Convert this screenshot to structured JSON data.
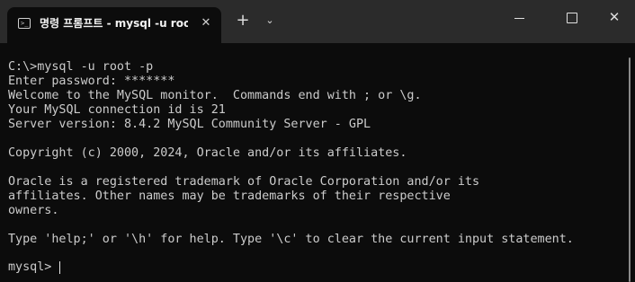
{
  "window": {
    "tab_title": "명령 프롬프트 - mysql  -u root",
    "tab_icon": "terminal-icon",
    "close_tab_symbol": "✕",
    "new_tab_symbol": "+",
    "dropdown_symbol": "⌄",
    "minimize_icon": "minimize-icon",
    "maximize_icon": "maximize-icon",
    "close_window_symbol": "✕"
  },
  "terminal": {
    "lines": [
      "C:\\>mysql -u root -p",
      "Enter password: *******",
      "Welcome to the MySQL monitor.  Commands end with ; or \\g.",
      "Your MySQL connection id is 21",
      "Server version: 8.4.2 MySQL Community Server - GPL",
      "",
      "Copyright (c) 2000, 2024, Oracle and/or its affiliates.",
      "",
      "Oracle is a registered trademark of Oracle Corporation and/or its",
      "affiliates. Other names may be trademarks of their respective",
      "owners.",
      "",
      "Type 'help;' or '\\h' for help. Type '\\c' to clear the current input statement.",
      "",
      "mysql> "
    ]
  }
}
